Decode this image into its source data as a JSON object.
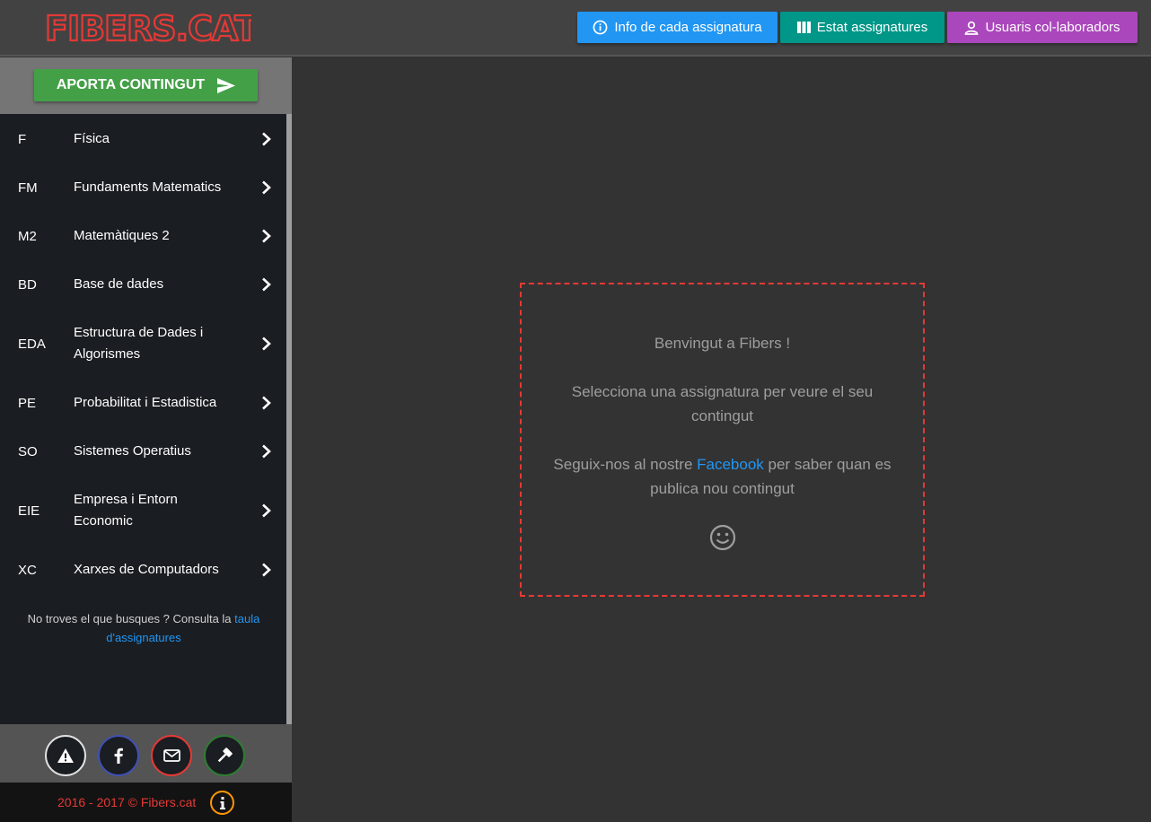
{
  "header": {
    "logo_text": "FIBERS.CAT",
    "buttons": {
      "info": "Info de cada assignatura",
      "estat": "Estat assignatures",
      "users": "Usuaris col-laboradors"
    }
  },
  "sidebar": {
    "contribute_label": "APORTA CONTINGUT",
    "items": [
      {
        "code": "F",
        "label": "Física"
      },
      {
        "code": "FM",
        "label": "Fundaments Matematics"
      },
      {
        "code": "M2",
        "label": "Matemàtiques 2"
      },
      {
        "code": "BD",
        "label": "Base de dades"
      },
      {
        "code": "EDA",
        "label": "Estructura de Dades i Algorismes"
      },
      {
        "code": "PE",
        "label": "Probabilitat i Estadistica"
      },
      {
        "code": "SO",
        "label": "Sistemes Operatius"
      },
      {
        "code": "EIE",
        "label": "Empresa i Entorn Economic"
      },
      {
        "code": "XC",
        "label": "Xarxes de Computadors"
      }
    ],
    "help_prefix": "No troves el que busques ? Consulta la ",
    "help_link": "taula d'assignatures"
  },
  "footer": {
    "copyright": "2016 - 2017 © Fibers.cat"
  },
  "welcome": {
    "line1": "Benvingut a Fibers !",
    "line2": "Selecciona una assignatura per veure el seu contingut",
    "line3_prefix": "Seguix-nos al nostre ",
    "line3_link": "Facebook",
    "line3_suffix": " per saber quan es publica nou contingut"
  },
  "colors": {
    "info": "#2196f3",
    "estat": "#009688",
    "users": "#ab47bc",
    "contribute": "#43a047",
    "accent_red": "#e53935"
  }
}
